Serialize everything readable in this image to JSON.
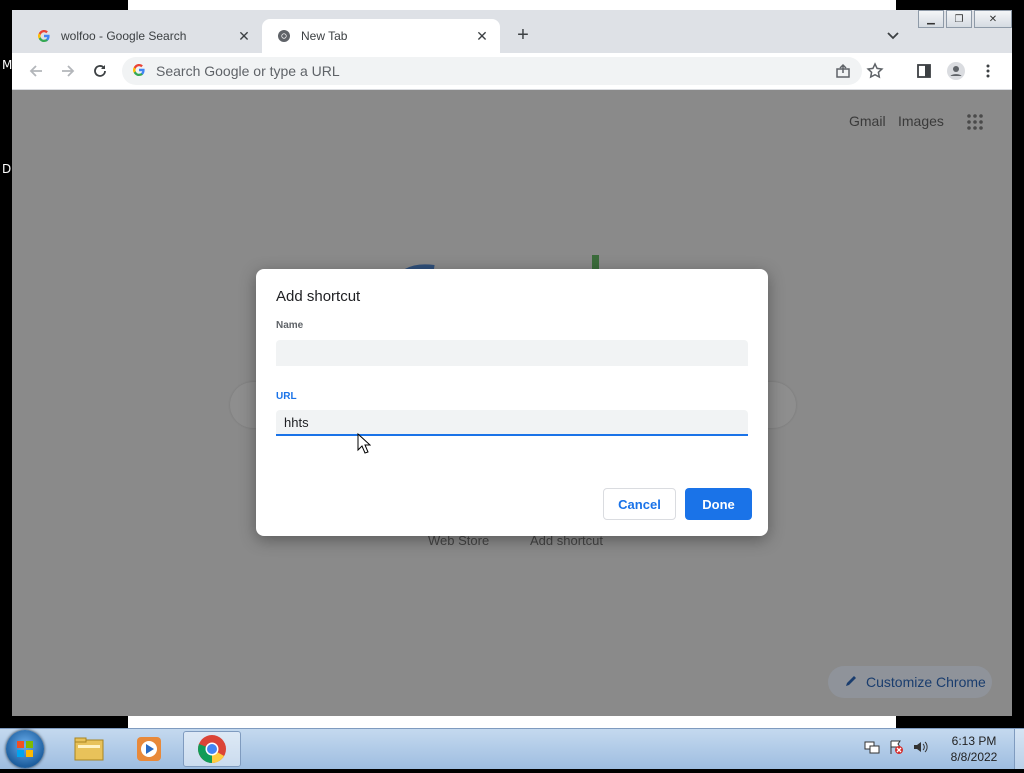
{
  "tabs": [
    {
      "title": "wolfoo - Google Search",
      "favicon": "google-g-icon"
    },
    {
      "title": "New Tab",
      "favicon": "chrome-icon"
    }
  ],
  "omnibox": {
    "placeholder": "Search Google or type a URL"
  },
  "ntp": {
    "gmail": "Gmail",
    "images": "Images",
    "shortcut_labels": [
      "Web Store",
      "Add shortcut"
    ],
    "customize": "Customize Chrome"
  },
  "dialog": {
    "title": "Add shortcut",
    "name_label": "Name",
    "name_value": "",
    "url_label": "URL",
    "url_value": "hhts",
    "cancel": "Cancel",
    "done": "Done"
  },
  "taskbar": {
    "time": "6:13 PM",
    "date": "8/8/2022"
  },
  "desktop": {
    "letters": [
      "M",
      "D"
    ]
  },
  "colors": {
    "accent": "#1a73e8",
    "scrim": "#8a8a8a"
  }
}
